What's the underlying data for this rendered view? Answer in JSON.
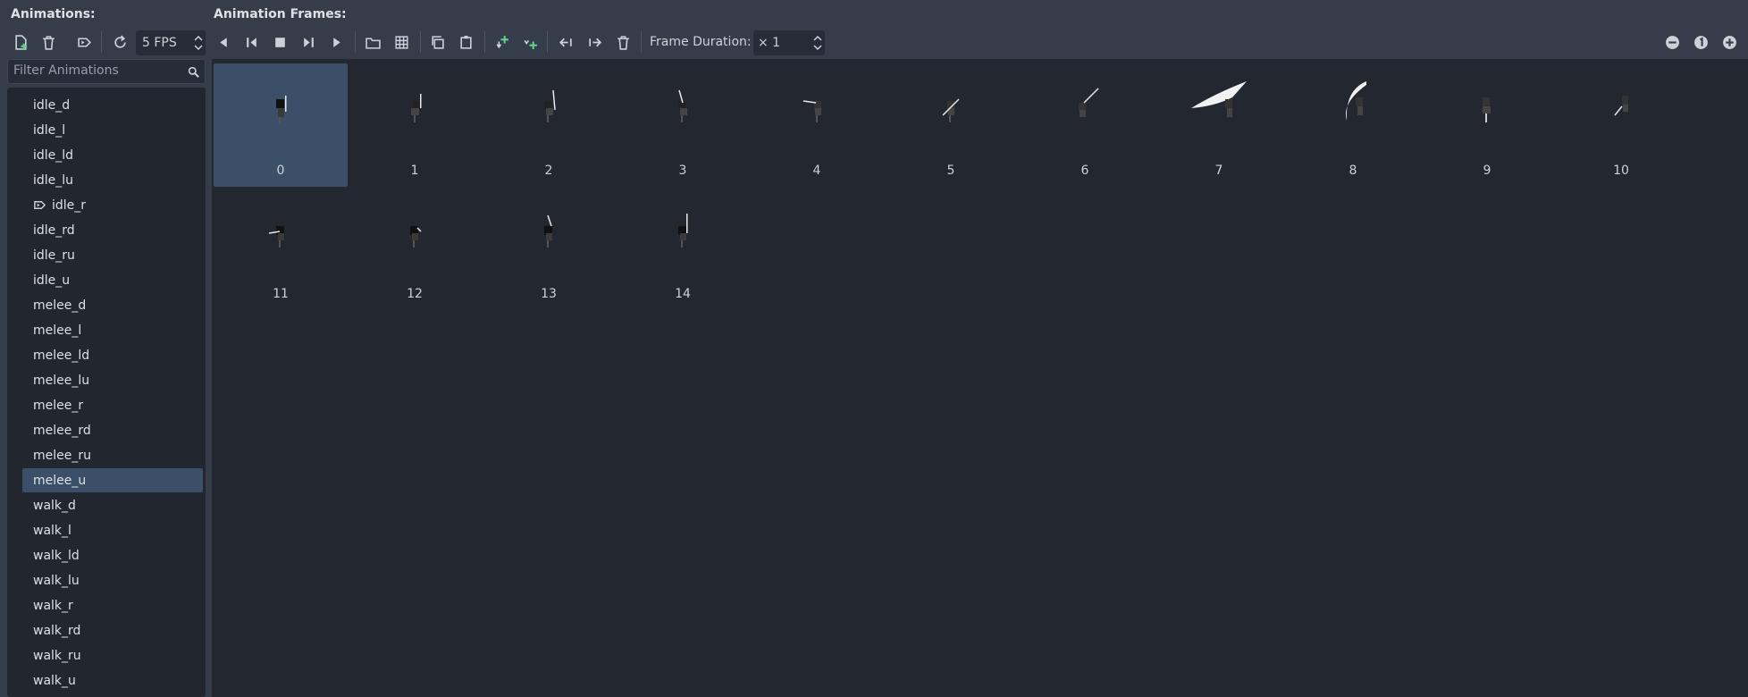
{
  "animations_panel": {
    "title": "Animations:",
    "fps_value": "5 FPS",
    "filter_placeholder": "Filter Animations",
    "items": [
      {
        "label": "idle_d"
      },
      {
        "label": "idle_l"
      },
      {
        "label": "idle_ld"
      },
      {
        "label": "idle_lu"
      },
      {
        "label": "idle_r",
        "autoplay_icon": "autoplay-tag-icon"
      },
      {
        "label": "idle_rd"
      },
      {
        "label": "idle_ru"
      },
      {
        "label": "idle_u"
      },
      {
        "label": "melee_d"
      },
      {
        "label": "melee_l"
      },
      {
        "label": "melee_ld"
      },
      {
        "label": "melee_lu"
      },
      {
        "label": "melee_r"
      },
      {
        "label": "melee_rd"
      },
      {
        "label": "melee_ru"
      },
      {
        "label": "melee_u",
        "selected": true
      },
      {
        "label": "walk_d"
      },
      {
        "label": "walk_l"
      },
      {
        "label": "walk_ld"
      },
      {
        "label": "walk_lu"
      },
      {
        "label": "walk_r"
      },
      {
        "label": "walk_rd"
      },
      {
        "label": "walk_ru"
      },
      {
        "label": "walk_u"
      }
    ]
  },
  "frames_panel": {
    "title": "Animation Frames:",
    "frame_duration_label": "Frame Duration:",
    "frame_duration_value": "× 1",
    "frames": [
      "0",
      "1",
      "2",
      "3",
      "4",
      "5",
      "6",
      "7",
      "8",
      "9",
      "10",
      "11",
      "12",
      "13",
      "14"
    ],
    "selected_frame": "0"
  },
  "colors": {
    "background": "#363d4a",
    "panel": "#232830",
    "selection": "#3b5068",
    "add_icon": "#5fd18a"
  },
  "icons": {
    "animations_toolbar": [
      "new-animation-icon",
      "delete-animation-icon",
      "autoplay-on-load-icon",
      "loop-icon"
    ],
    "playback": [
      "play-backwards-icon",
      "play-backwards-from-end-icon",
      "stop-icon",
      "play-from-start-icon",
      "play-icon"
    ],
    "frames_toolbar": [
      "add-frame-from-file-icon",
      "add-frames-from-sprite-sheet-icon",
      "copy-frame-icon",
      "paste-frame-icon",
      "insert-before-icon",
      "insert-after-icon",
      "move-left-icon",
      "move-right-icon",
      "delete-frame-icon"
    ],
    "zoom": [
      "zoom-out-icon",
      "zoom-reset-icon",
      "zoom-in-icon"
    ]
  }
}
